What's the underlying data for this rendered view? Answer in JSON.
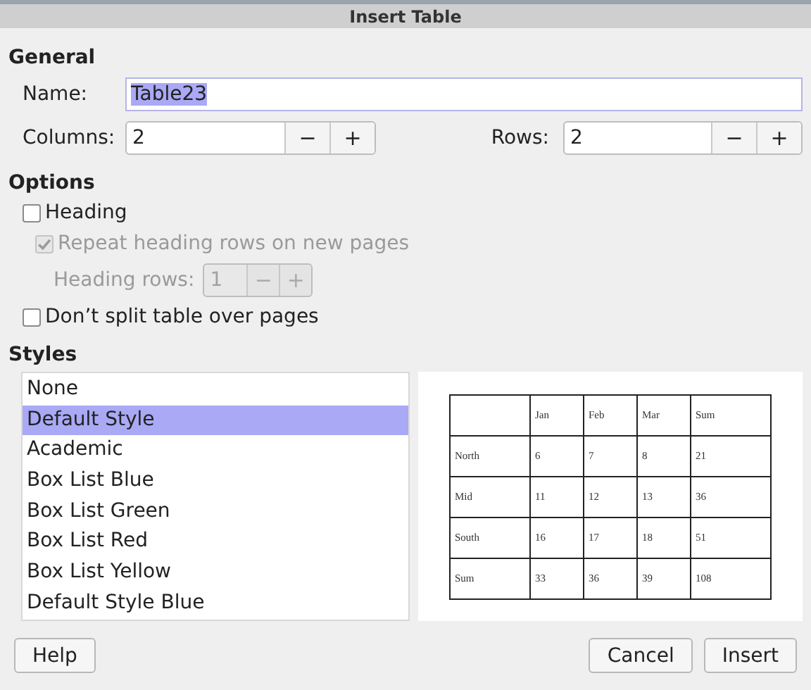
{
  "window": {
    "title": "Insert Table"
  },
  "general": {
    "heading": "General",
    "name": {
      "label": "Name:",
      "value": "Table23"
    },
    "columns": {
      "label": "Columns:",
      "value": "2",
      "minus": "−",
      "plus": "+"
    },
    "rows": {
      "label": "Rows:",
      "value": "2",
      "minus": "−",
      "plus": "+"
    }
  },
  "options": {
    "heading": "Options",
    "items": [
      {
        "kind": "check",
        "label": "Heading",
        "checked": false,
        "disabled": false
      },
      {
        "kind": "check",
        "label": "Repeat heading rows on new pages",
        "checked": true,
        "disabled": true
      },
      {
        "kind": "spin",
        "label": "Heading rows:",
        "value": "1",
        "minus": "−",
        "plus": "+",
        "disabled": true
      },
      {
        "kind": "check",
        "label": "Don’t split table over pages",
        "checked": false,
        "disabled": false
      }
    ]
  },
  "styles": {
    "heading": "Styles",
    "items": [
      {
        "label": "None",
        "selected": false
      },
      {
        "label": "Default Style",
        "selected": true
      },
      {
        "label": "Academic",
        "selected": false
      },
      {
        "label": "Box List Blue",
        "selected": false
      },
      {
        "label": "Box List Green",
        "selected": false
      },
      {
        "label": "Box List Red",
        "selected": false
      },
      {
        "label": "Box List Yellow",
        "selected": false
      },
      {
        "label": "Default Style Blue",
        "selected": false
      }
    ],
    "preview": {
      "columns": [
        "Jan",
        "Feb",
        "Mar",
        "Sum"
      ],
      "rows": [
        {
          "label": "North",
          "values": [
            "6",
            "7",
            "8",
            "21"
          ]
        },
        {
          "label": "Mid",
          "values": [
            "11",
            "12",
            "13",
            "36"
          ]
        },
        {
          "label": "South",
          "values": [
            "16",
            "17",
            "18",
            "51"
          ]
        },
        {
          "label": "Sum",
          "values": [
            "33",
            "36",
            "39",
            "108"
          ]
        }
      ]
    }
  },
  "buttons": {
    "help": "Help",
    "cancel": "Cancel",
    "insert": "Insert"
  }
}
